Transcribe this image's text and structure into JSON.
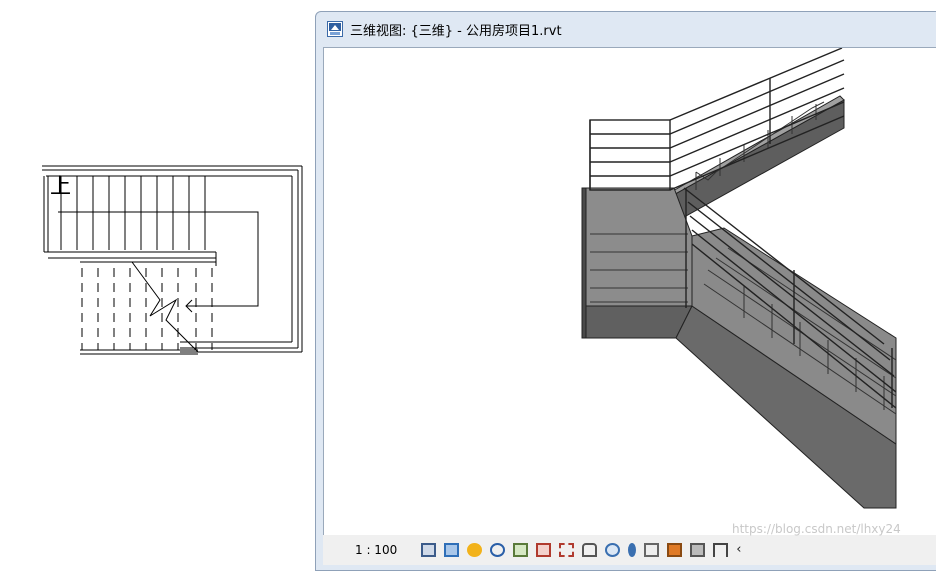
{
  "plan_view": {
    "up_label": "上"
  },
  "view_window": {
    "title": "三维视图: {三维} - 公用房项目1.rvt",
    "app_icon": "revit-project-icon",
    "view_control_bar": {
      "scale": "1 : 100",
      "icons": [
        "detail-level-icon",
        "visual-style-icon",
        "sun-path-icon",
        "shadows-icon",
        "render-icon",
        "crop-view-icon",
        "show-crop-region-icon",
        "unlock-3d-view-icon",
        "temporary-hide-icon",
        "reveal-hidden-icon",
        "temporary-view-properties-icon",
        "highlight-displacement-icon",
        "analytical-model-icon",
        "constraints-icon",
        "scroll-left-icon"
      ]
    }
  },
  "watermark": "https://blog.csdn.net/lhxy24",
  "colors": {
    "window_frame": "#dfe8f3",
    "stair_top": "#9a9a9a",
    "stair_side": "#5a5a5a",
    "stair_landing": "#8c8c8c"
  }
}
